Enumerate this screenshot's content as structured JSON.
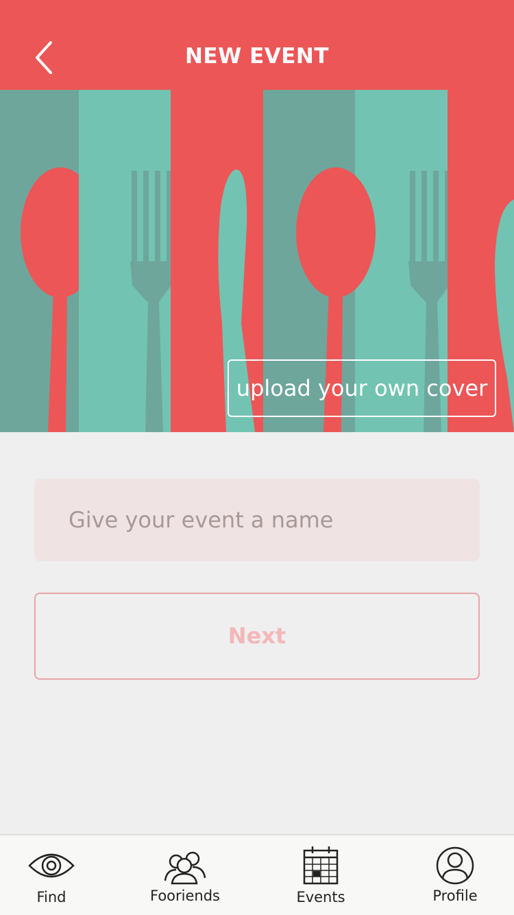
{
  "header": {
    "title": "NEW EVENT",
    "back_icon": "chevron-left-icon"
  },
  "cover": {
    "upload_label": "upload your own cover"
  },
  "form": {
    "name_placeholder": "Give your event a name",
    "name_value": "",
    "next_label": "Next"
  },
  "tabs": [
    {
      "label": "Find",
      "icon": "eye-icon"
    },
    {
      "label": "Fooriends",
      "icon": "friends-icon"
    },
    {
      "label": "Events",
      "icon": "calendar-icon"
    },
    {
      "label": "Profile",
      "icon": "user-circle-icon"
    }
  ],
  "colors": {
    "primary": "#ec5657",
    "teal_dark": "#6ea69c",
    "teal_light": "#73c3b2",
    "background": "#efefef",
    "input_bg": "#efe4e3",
    "next_border": "#e7a3a8"
  }
}
